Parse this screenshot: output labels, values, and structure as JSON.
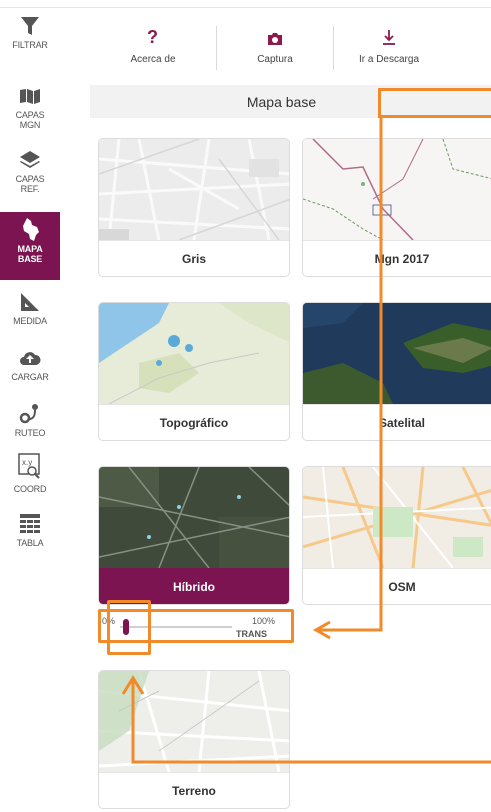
{
  "sidebar": {
    "items": [
      {
        "label": "FILTRAR",
        "icon": "funnel-icon"
      },
      {
        "label": "CAPAS\nMGN",
        "icon": "map-layers-icon"
      },
      {
        "label": "CAPAS\nREF.",
        "icon": "stack-icon"
      },
      {
        "label": "MAPA\nBASE",
        "icon": "colombia-map-icon",
        "active": true
      },
      {
        "label": "MEDIDA",
        "icon": "ruler-icon"
      },
      {
        "label": "CARGAR",
        "icon": "cloud-upload-icon"
      },
      {
        "label": "RUTEO",
        "icon": "route-icon"
      },
      {
        "label": "COORD",
        "icon": "coordinates-icon"
      },
      {
        "label": "TABLA",
        "icon": "table-icon"
      }
    ]
  },
  "toolbar": {
    "about_label": "Acerca de",
    "capture_label": "Captura",
    "download_label": "Ir a Descarga"
  },
  "panel": {
    "title": "Mapa base"
  },
  "basemaps": [
    {
      "label": "Gris"
    },
    {
      "label": "Mgn 2017"
    },
    {
      "label": "Topográfico"
    },
    {
      "label": "Satelital"
    },
    {
      "label": "Híbrido",
      "selected": true
    },
    {
      "label": "OSM"
    },
    {
      "label": "Terreno"
    }
  ],
  "transparency": {
    "min_label": "0%",
    "max_label": "100%",
    "label": "TRANS",
    "value_percent": 5
  },
  "colors": {
    "accent": "#7b1450",
    "annotation": "#f08a2a"
  }
}
